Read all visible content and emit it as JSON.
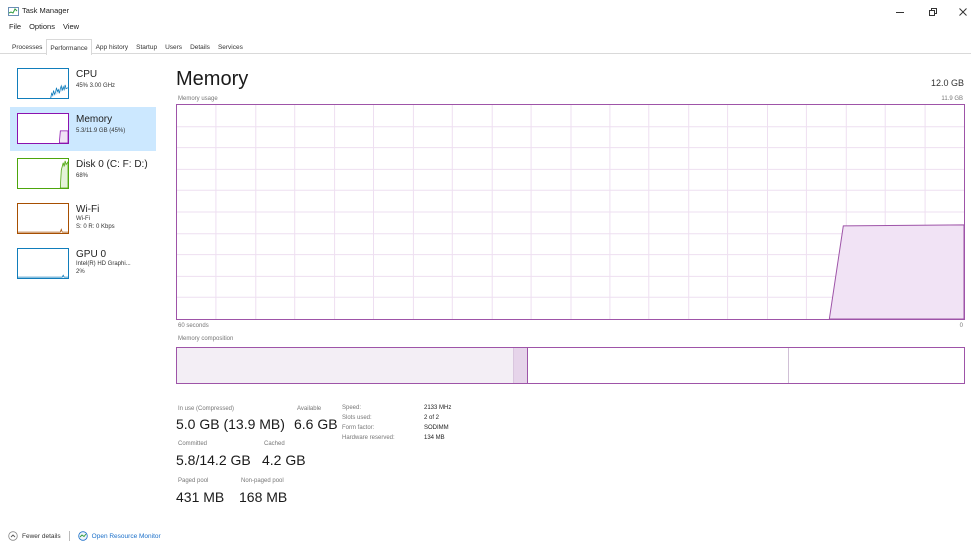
{
  "window": {
    "title": "Task Manager"
  },
  "menu": [
    "File",
    "Options",
    "View"
  ],
  "tabs": [
    {
      "label": "Processes",
      "active": false
    },
    {
      "label": "Performance",
      "active": true
    },
    {
      "label": "App history",
      "active": false
    },
    {
      "label": "Startup",
      "active": false
    },
    {
      "label": "Users",
      "active": false
    },
    {
      "label": "Details",
      "active": false
    },
    {
      "label": "Services",
      "active": false
    }
  ],
  "sidebar": {
    "items": [
      {
        "name": "CPU",
        "lines": [
          "45% 3.00 GHz"
        ],
        "color": "#117dbb",
        "selected": false
      },
      {
        "name": "Memory",
        "lines": [
          "5.3/11.9 GB (45%)"
        ],
        "color": "#8b12ae",
        "selected": true
      },
      {
        "name": "Disk 0 (C: F: D:)",
        "lines": [
          "68%"
        ],
        "color": "#4da60c",
        "selected": false
      },
      {
        "name": "Wi-Fi",
        "lines": [
          "Wi-Fi",
          "S: 0 R: 0 Kbps"
        ],
        "color": "#a74f01",
        "selected": false
      },
      {
        "name": "GPU 0",
        "lines": [
          "Intel(R) HD Graphi...",
          "2%"
        ],
        "color": "#117dbb",
        "selected": false
      }
    ]
  },
  "main": {
    "title": "Memory",
    "total": "12.0 GB",
    "usage_label": "Memory usage",
    "usage_max": "11.9 GB",
    "axis_left": "60 seconds",
    "axis_right": "0",
    "composition_label": "Memory composition",
    "accent_color": "#9e54a8"
  },
  "stats": {
    "in_use_label": "In use (Compressed)",
    "in_use_value": "5.0 GB (13.9 MB)",
    "available_label": "Available",
    "available_value": "6.6 GB",
    "committed_label": "Committed",
    "committed_value": "5.8/14.2 GB",
    "cached_label": "Cached",
    "cached_value": "4.2 GB",
    "paged_label": "Paged pool",
    "paged_value": "431 MB",
    "nonpaged_label": "Non-paged pool",
    "nonpaged_value": "168 MB"
  },
  "specs": [
    {
      "label": "Speed:",
      "value": "2133 MHz"
    },
    {
      "label": "Slots used:",
      "value": "2 of 2"
    },
    {
      "label": "Form factor:",
      "value": "SODIMM"
    },
    {
      "label": "Hardware reserved:",
      "value": "134 MB"
    }
  ],
  "footer": {
    "fewer_details": "Fewer details",
    "open_resource_monitor": "Open Resource Monitor"
  }
}
